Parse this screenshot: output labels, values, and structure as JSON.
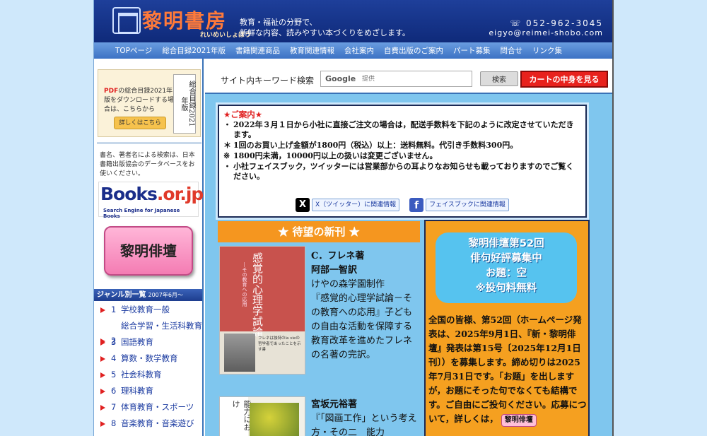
{
  "header": {
    "logo_title": "黎明書房",
    "logo_sub": "れいめいしょぼう",
    "tagline_1": "教育・福祉の分野で、",
    "tagline_2": "新鮮な内容、読みやすい本づくりをめざします。",
    "phone": "☏ 052-962-3045",
    "email": "eigyo@reimei-shobo.com"
  },
  "nav": [
    "TOPページ",
    "総合目録2021年版",
    "書籍関連商品",
    "教育関連情報",
    "会社案内",
    "自費出版のご案内",
    "パート募集",
    "問合せ",
    "リンク集"
  ],
  "sidebar": {
    "pdf_prefix": "PDF",
    "pdf_text": "の総合目録2021年版をダウンロードする場合は、こちらから",
    "pdf_button": "詳しくはこちら",
    "pdf_book": "総合目録2021年版",
    "search_note": "書名、著者名による検索は、日本書籍出版協会のデータベースをお使いください。",
    "books_logo_1": "Books",
    "books_logo_2": ".or.jp",
    "books_logo_sub": "Search Engine for Japanese Books",
    "haidan_button": "黎明俳壇",
    "genre_title": "ジャンル別一覧",
    "genre_date": "2007年6月～",
    "genres": [
      {
        "num": "1",
        "label": "学校教育一般"
      },
      {
        "num": "2",
        "label": "総合学習・生活科教育"
      },
      {
        "num": "3",
        "label": "国語教育"
      },
      {
        "num": "4",
        "label": "算数・数学教育"
      },
      {
        "num": "5",
        "label": "社会科教育"
      },
      {
        "num": "6",
        "label": "理科教育"
      },
      {
        "num": "7",
        "label": "体育教育・スポーツ"
      },
      {
        "num": "8",
        "label": "音楽教育・音楽遊び"
      }
    ]
  },
  "search": {
    "label": "サイト内キーワード検索",
    "google": "Google",
    "placeholder": "提供",
    "button": "検索",
    "cart_button": "カートの中身を見る"
  },
  "notice": {
    "title": "★ご案内★",
    "items": [
      {
        "bullet": "・",
        "text": "2022年３月１日から小社に直接ご注文の場合は，配送手数料を下記のように改定させていただきます。"
      },
      {
        "bullet": "＊",
        "text": "1回のお買い上げ金額が1800円（税込）以上：送料無料。代引き手数料300円。"
      },
      {
        "bullet": "※",
        "text": "1800円未満，10000円以上の扱いは変更ございません。"
      },
      {
        "bullet": "・",
        "text": "小社フェイスブック，ツイッターには営業部からの耳よりなお知らせも載っておりますのでご覧ください。"
      }
    ],
    "x_link": "X（ツイッター）に関連情報",
    "fb_link": "フェイスブックに関連情報"
  },
  "new_books": {
    "title": "★ 待望の新刊 ★",
    "book1": {
      "cover_title": "感覚的心理学試論",
      "cover_sub": "―その教育への応用",
      "cover_text": "フレネは独特のla vieの哲学者であったことを示す書",
      "author": "C．フレネ著",
      "translator": "阿部一智訳",
      "producer": "けやの森学園制作",
      "desc": "『感覚的心理学試論－その教育への応用』子どもの自由な活動を保障する教育改革を進めたフレネの名著の完訳。"
    },
    "book2": {
      "cover_title": "能力におけ",
      "author": "宮坂元裕著",
      "desc": "『「図画工作」という考え方・その二　能力"
    }
  },
  "haiku": {
    "head_1": "黎明俳壇第52回",
    "head_2": "俳句好評募集中",
    "head_3": "お題：空",
    "head_4": "※投句料無料",
    "body": "全国の皆様、第52回（ホームページ発表は、2025年9月1日、『新・黎明俳壇』発表は第15号〔2025年12月1日刊〕）を募集します。締め切りは2025年7月31日です。「お題」を出しますが，お題にそった句でなくても結構です。ご自由にご投句ください。応募について，詳しくは，",
    "tag": "黎明俳壇"
  }
}
